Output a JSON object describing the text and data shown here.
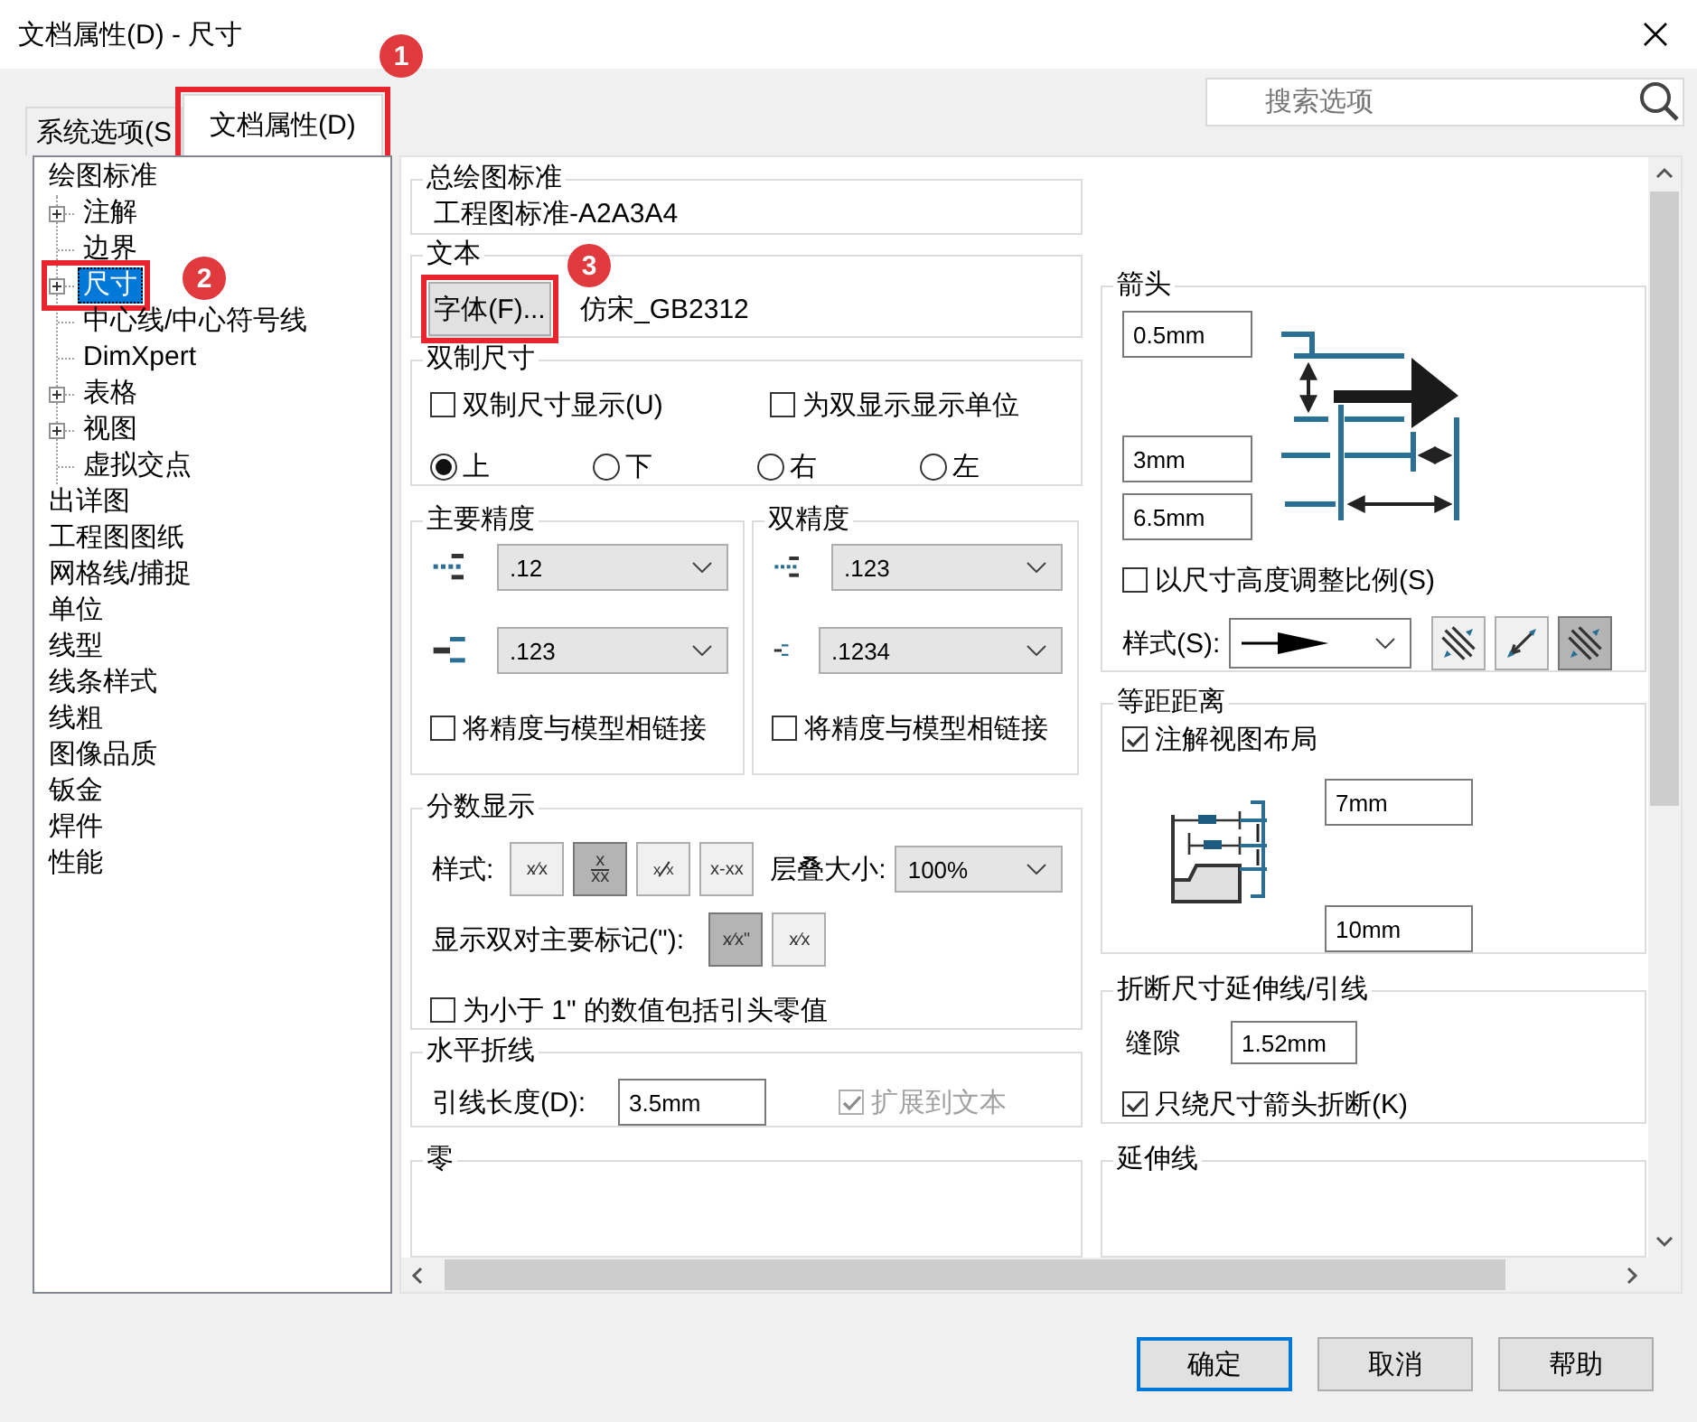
{
  "window": {
    "title": "文档属性(D) - 尺寸"
  },
  "tabs": [
    {
      "label": "系统选项(S",
      "selected": false,
      "highlighted": false
    },
    {
      "label": "文档属性(D)",
      "selected": true,
      "highlighted": true
    }
  ],
  "search": {
    "placeholder": "搜索选项"
  },
  "tree": [
    {
      "label": "绘图标准",
      "selected": false,
      "highlighted": false,
      "children": [
        {
          "label": "注解",
          "selected": false,
          "expandable": true,
          "highlighted": false
        },
        {
          "label": "边界",
          "selected": false,
          "expandable": false,
          "highlighted": false
        },
        {
          "label": "尺寸",
          "selected": true,
          "expandable": true,
          "highlighted": true
        },
        {
          "label": "中心线/中心符号线",
          "selected": false,
          "expandable": false,
          "highlighted": false
        },
        {
          "label": "DimXpert",
          "selected": false,
          "expandable": false,
          "highlighted": false
        },
        {
          "label": "表格",
          "selected": false,
          "expandable": true,
          "highlighted": false
        },
        {
          "label": "视图",
          "selected": false,
          "expandable": true,
          "highlighted": false
        },
        {
          "label": "虚拟交点",
          "selected": false,
          "expandable": false,
          "highlighted": false
        }
      ]
    },
    {
      "label": "出详图",
      "selected": false,
      "highlighted": false
    },
    {
      "label": "工程图图纸",
      "selected": false,
      "highlighted": false
    },
    {
      "label": "网格线/捕捉",
      "selected": false,
      "highlighted": false
    },
    {
      "label": "单位",
      "selected": false,
      "highlighted": false
    },
    {
      "label": "线型",
      "selected": false,
      "highlighted": false
    },
    {
      "label": "线条样式",
      "selected": false,
      "highlighted": false
    },
    {
      "label": "线粗",
      "selected": false,
      "highlighted": false
    },
    {
      "label": "图像品质",
      "selected": false,
      "highlighted": false
    },
    {
      "label": "钣金",
      "selected": false,
      "highlighted": false
    },
    {
      "label": "焊件",
      "selected": false,
      "highlighted": false
    },
    {
      "label": "性能",
      "selected": false,
      "highlighted": false
    }
  ],
  "overall_standard": {
    "title": "总绘图标准",
    "value": "工程图标准-A2A3A4"
  },
  "text": {
    "title": "文本",
    "font_button": {
      "label": "字体(F)...",
      "highlighted": true
    },
    "font_name": "仿宋_GB2312"
  },
  "dual_dimensions": {
    "title": "双制尺寸",
    "checkboxes": [
      {
        "label": "双制尺寸显示(U)",
        "checked": false
      },
      {
        "label": "为双显示显示单位",
        "checked": false
      }
    ],
    "positions": [
      {
        "label": "上",
        "selected": true
      },
      {
        "label": "下",
        "selected": false
      },
      {
        "label": "右",
        "selected": false
      },
      {
        "label": "左",
        "selected": false
      }
    ]
  },
  "primary_precision": {
    "title": "主要精度",
    "value_precision": ".12",
    "tolerance_precision": ".123",
    "link": {
      "label": "将精度与模型相链接",
      "checked": false
    }
  },
  "dual_precision": {
    "title": "双精度",
    "value_precision": ".123",
    "tolerance_precision": ".1234",
    "link": {
      "label": "将精度与模型相链接",
      "checked": false
    }
  },
  "fraction_display": {
    "title": "分数显示",
    "style_label": "样式:",
    "styles": [
      {
        "kind": "inline",
        "label": "x⁄x",
        "selected": false
      },
      {
        "kind": "stacked",
        "numerator": "x",
        "denominator": "xx",
        "selected": true
      },
      {
        "kind": "diagonal",
        "numerator": "x",
        "denominator": "x",
        "selected": false
      },
      {
        "kind": "inline",
        "label": "x-xx",
        "selected": false
      }
    ],
    "stack_size_label": "层叠大小:",
    "stack_size": "100%",
    "dual_mark_label": "显示双对主要标记(\"):",
    "dual_marks": [
      {
        "label": "x⁄x\"",
        "selected": true
      },
      {
        "label": "x⁄x",
        "selected": false
      }
    ],
    "leading_zero": {
      "label": "为小于 1\" 的数值包括引头零值",
      "checked": false
    }
  },
  "horizontal_break": {
    "title": "水平折线",
    "length_label": "引线长度(D):",
    "length": "3.5mm",
    "extend": {
      "label": "扩展到文本",
      "checked": true,
      "disabled": true
    }
  },
  "zero": {
    "title": "零"
  },
  "arrows": {
    "title": "箭头",
    "sizes": [
      "0.5mm",
      "3mm",
      "6.5mm"
    ],
    "scale": {
      "label": "以尺寸高度调整比例(S)",
      "checked": false
    },
    "style_label": "样式(S):",
    "placements": [
      {
        "selected": false
      },
      {
        "selected": false
      },
      {
        "selected": true
      }
    ]
  },
  "offset": {
    "title": "等距距离",
    "layout": {
      "label": "注解视图布局",
      "checked": true
    },
    "distances": [
      "7mm",
      "10mm"
    ]
  },
  "break_lines": {
    "title": "折断尺寸延伸线/引线",
    "gap_label": "缝隙",
    "gap": "1.52mm",
    "only_arrows": {
      "label": "只绕尺寸箭头折断(K)",
      "checked": true
    }
  },
  "extension_lines": {
    "title": "延伸线"
  },
  "buttons": [
    {
      "label": "确定",
      "default": true
    },
    {
      "label": "取消",
      "default": false
    },
    {
      "label": "帮助",
      "default": false
    }
  ],
  "annotations": [
    {
      "label": "1"
    },
    {
      "label": "2"
    },
    {
      "label": "3"
    }
  ]
}
